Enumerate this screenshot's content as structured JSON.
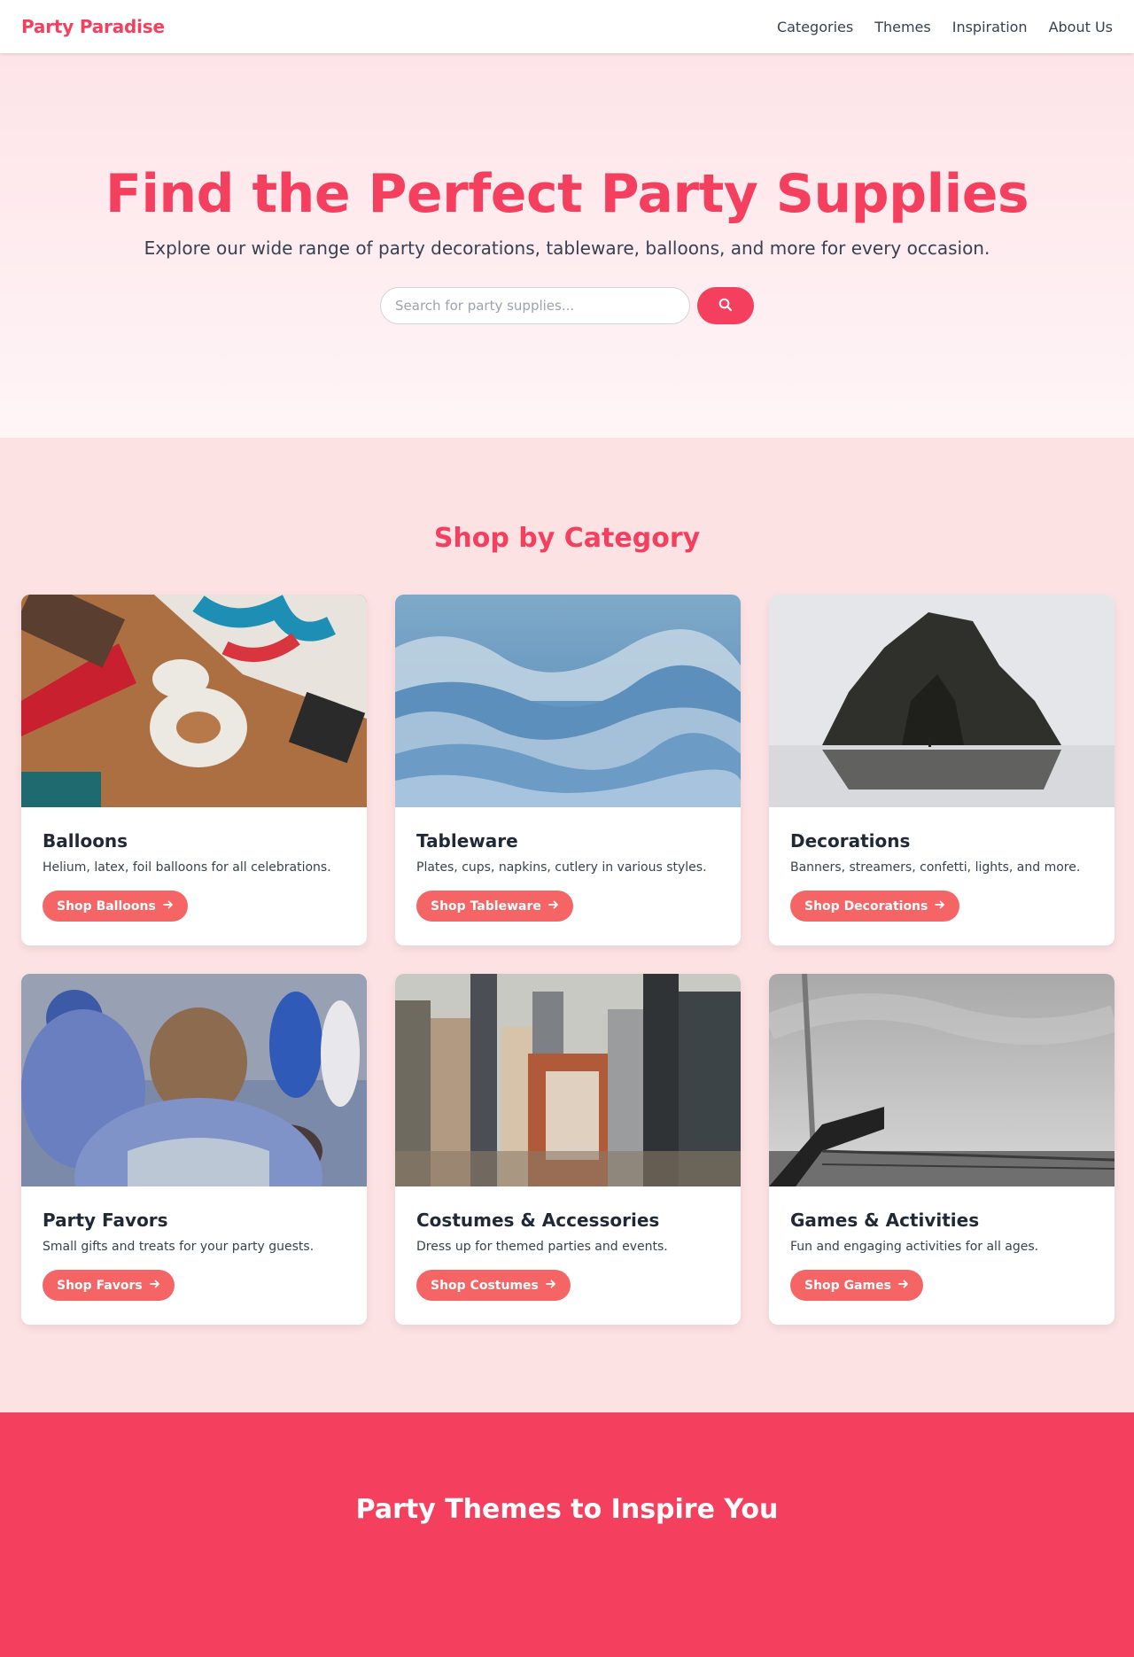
{
  "nav": {
    "brand": "Party Paradise",
    "links": [
      "Categories",
      "Themes",
      "Inspiration",
      "About Us"
    ]
  },
  "hero": {
    "title": "Find the Perfect Party Supplies",
    "subtitle": "Explore our wide range of party decorations, tableware, balloons, and more for every occasion.",
    "search_placeholder": "Search for party supplies...",
    "search_icon": "search-icon"
  },
  "categories": {
    "title": "Shop by Category",
    "items": [
      {
        "title": "Balloons",
        "description": "Helium, latex, foil balloons for all celebrations.",
        "button": "Shop Balloons"
      },
      {
        "title": "Tableware",
        "description": "Plates, cups, napkins, cutlery in various styles.",
        "button": "Shop Tableware"
      },
      {
        "title": "Decorations",
        "description": "Banners, streamers, confetti, lights, and more.",
        "button": "Shop Decorations"
      },
      {
        "title": "Party Favors",
        "description": "Small gifts and treats for your party guests.",
        "button": "Shop Favors"
      },
      {
        "title": "Costumes & Accessories",
        "description": "Dress up for themed parties and events.",
        "button": "Shop Costumes"
      },
      {
        "title": "Games & Activities",
        "description": "Fun and engaging activities for all ages.",
        "button": "Shop Games"
      }
    ]
  },
  "themes": {
    "title": "Party Themes to Inspire You"
  },
  "colors": {
    "accent": "#f43f5e",
    "button": "#f56565",
    "section_bg": "#fde2e4"
  }
}
